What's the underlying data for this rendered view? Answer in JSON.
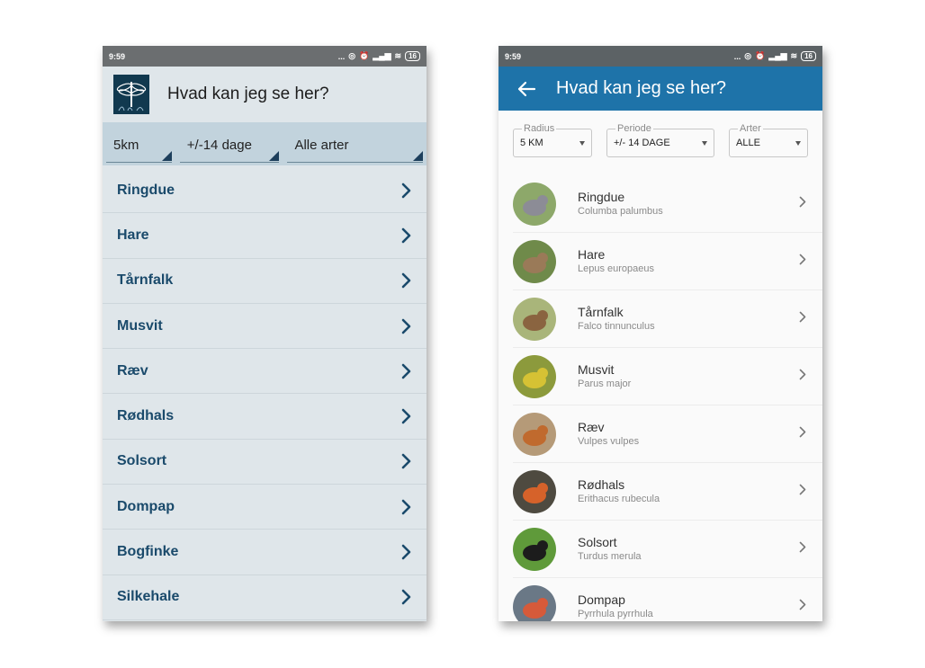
{
  "left": {
    "status": {
      "time": "9:59",
      "signal": "...",
      "battery": "16"
    },
    "title": "Hvad kan jeg se her?",
    "filters": [
      "5km",
      "+/-14 dage",
      "Alle arter"
    ],
    "species": [
      "Ringdue",
      "Hare",
      "Tårnfalk",
      "Musvit",
      "Ræv",
      "Rødhals",
      "Solsort",
      "Dompap",
      "Bogfinke",
      "Silkehale"
    ],
    "colors": {
      "label": "#1a4a6b",
      "chevron": "#1a4a6b",
      "filter_bar": "#c2d3dd"
    }
  },
  "right": {
    "status": {
      "time": "9:59",
      "signal": "...",
      "battery": "16"
    },
    "title": "Hvad kan jeg se her?",
    "filters": [
      {
        "legend": "Radius",
        "value": "5 KM"
      },
      {
        "legend": "Periode",
        "value": "+/- 14 DAGE"
      },
      {
        "legend": "Arter",
        "value": "ALLE"
      }
    ],
    "species": [
      {
        "name": "Ringdue",
        "latin": "Columba palumbus",
        "bg": "#8da86a",
        "fg": "#8c8c96"
      },
      {
        "name": "Hare",
        "latin": "Lepus europaeus",
        "bg": "#6f8a4a",
        "fg": "#9a7a58"
      },
      {
        "name": "Tårnfalk",
        "latin": "Falco tinnunculus",
        "bg": "#a9b57a",
        "fg": "#8a6440"
      },
      {
        "name": "Musvit",
        "latin": "Parus major",
        "bg": "#8c9a3c",
        "fg": "#d6c234"
      },
      {
        "name": "Ræv",
        "latin": "Vulpes vulpes",
        "bg": "#b59a78",
        "fg": "#c06a2e"
      },
      {
        "name": "Rødhals",
        "latin": "Erithacus rubecula",
        "bg": "#4e4a40",
        "fg": "#d6622a"
      },
      {
        "name": "Solsort",
        "latin": "Turdus merula",
        "bg": "#5f9a3a",
        "fg": "#1c1c1c"
      },
      {
        "name": "Dompap",
        "latin": "Pyrrhula pyrrhula",
        "bg": "#6a7886",
        "fg": "#d65a3a"
      }
    ],
    "colors": {
      "appbar": "#1e73a9"
    }
  }
}
